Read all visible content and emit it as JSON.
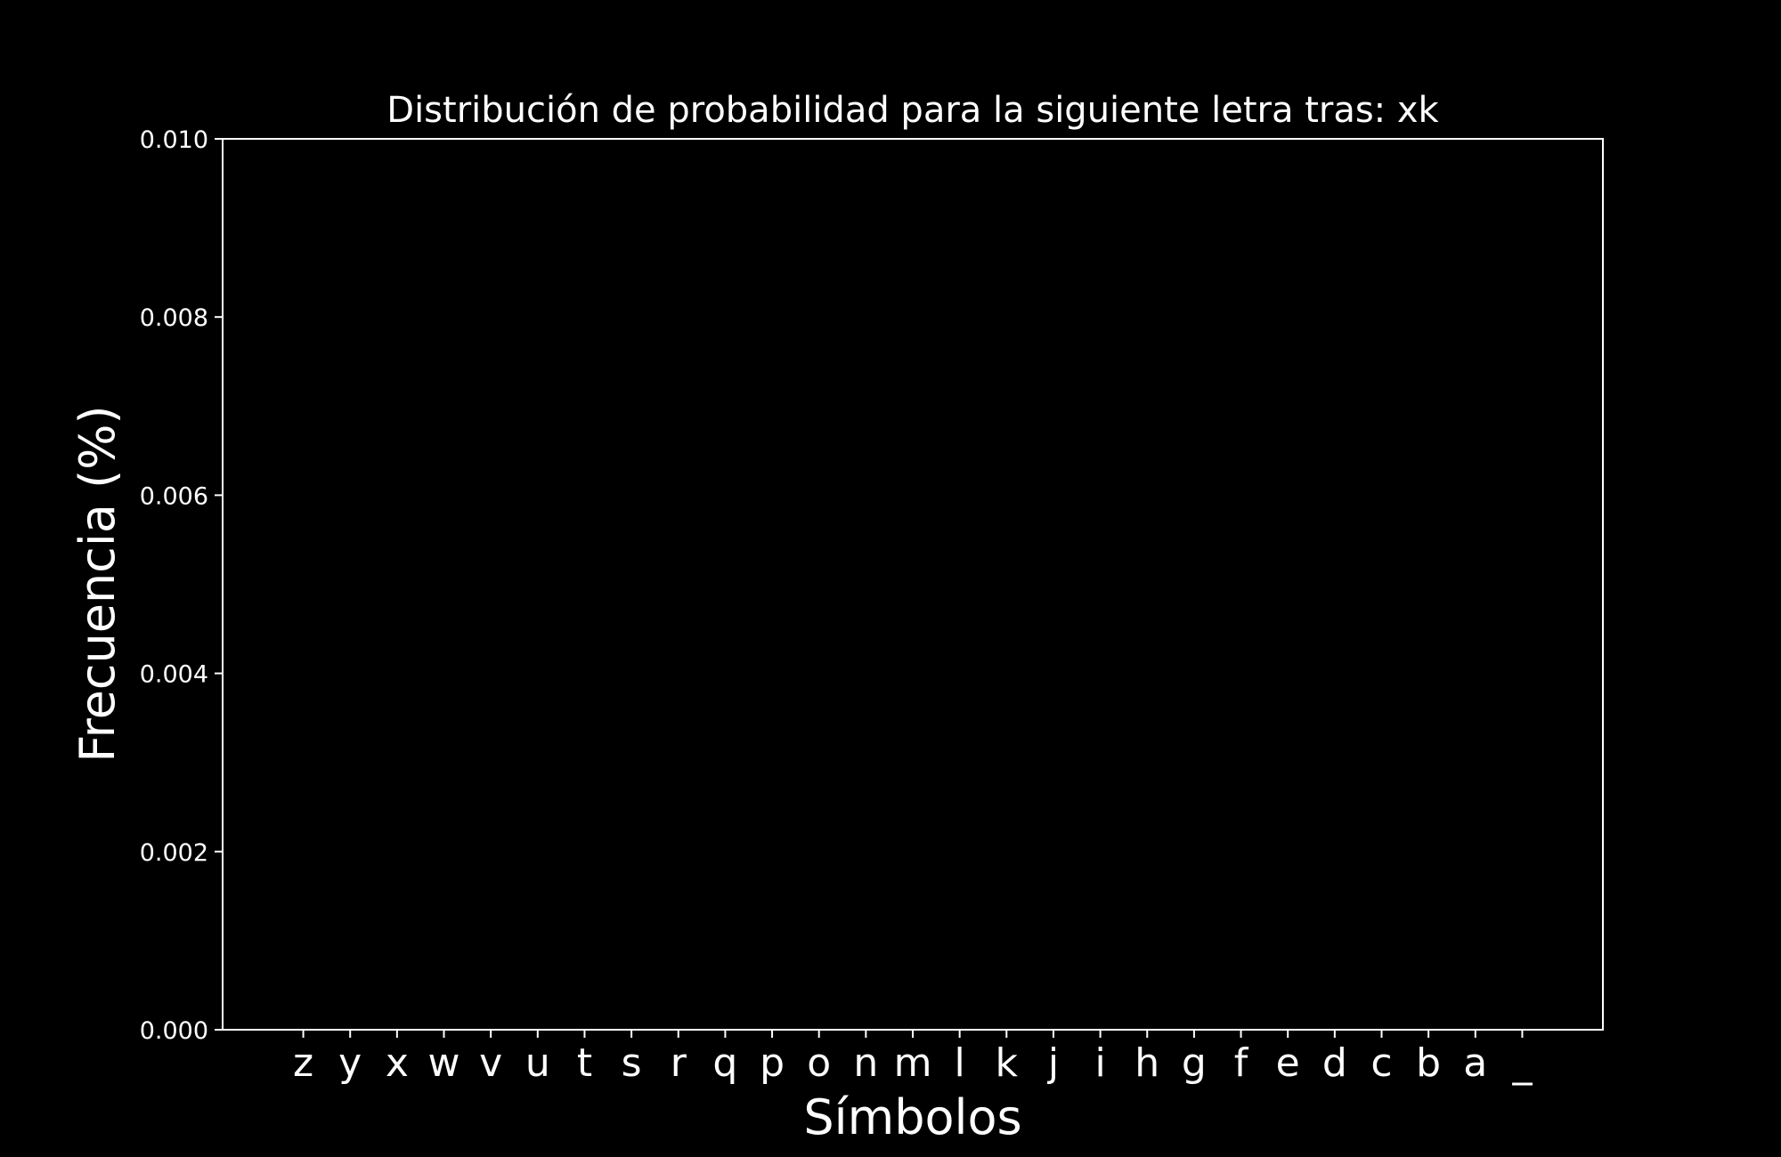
{
  "chart_data": {
    "type": "bar",
    "title": "Distribución de probabilidad para la siguiente letra tras: xk",
    "xlabel": "Símbolos",
    "ylabel": "Frecuencia (%)",
    "categories": [
      "z",
      "y",
      "x",
      "w",
      "v",
      "u",
      "t",
      "s",
      "r",
      "q",
      "p",
      "o",
      "n",
      "m",
      "l",
      "k",
      "j",
      "i",
      "h",
      "g",
      "f",
      "e",
      "d",
      "c",
      "b",
      "a",
      "_"
    ],
    "values": [
      0,
      0,
      0,
      0,
      0,
      0,
      0,
      0,
      0,
      0,
      0,
      0,
      0,
      0,
      0,
      0,
      0,
      0,
      0,
      0,
      0,
      0,
      0,
      0,
      0,
      0,
      0
    ],
    "ylim": [
      0,
      0.01
    ],
    "yticks": [
      "0.000",
      "0.002",
      "0.004",
      "0.006",
      "0.008",
      "0.010"
    ],
    "ytick_values": [
      0,
      0.002,
      0.004,
      0.006,
      0.008,
      0.01
    ],
    "grid": false,
    "background_color": "#000000",
    "foreground_color": "#ffffff",
    "bar_color": "#1f77b4"
  }
}
